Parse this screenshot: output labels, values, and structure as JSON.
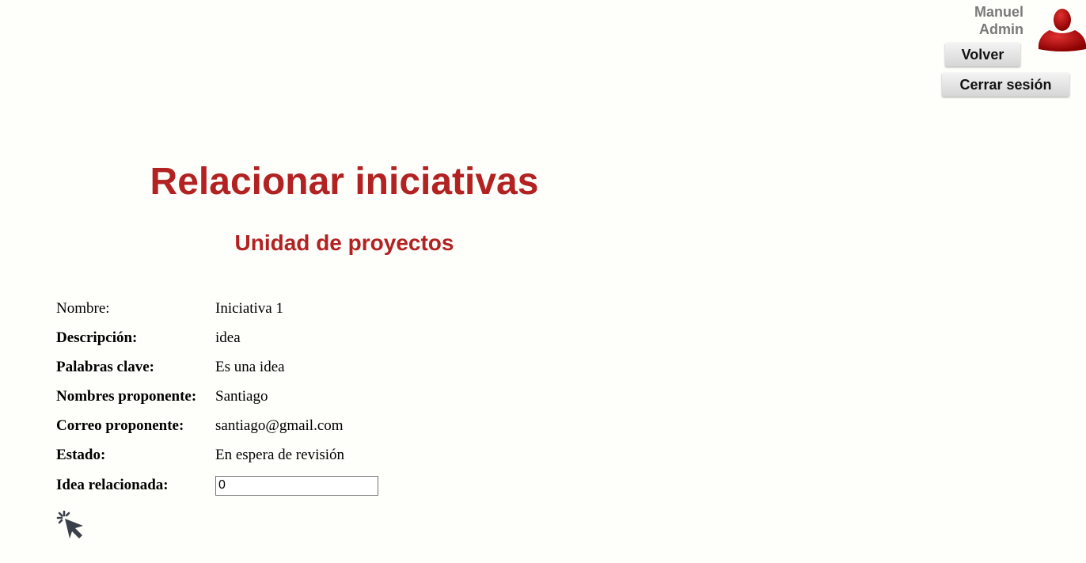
{
  "header": {
    "user_first_line": "Manuel",
    "user_second_line": "Admin",
    "avatar_icon": "user-silhouette-icon",
    "avatar_color": "#b00000",
    "back_button": "Volver",
    "logout_button": "Cerrar sesión"
  },
  "page": {
    "title": "Relacionar iniciativas",
    "subtitle": "Unidad de proyectos",
    "accent_color": "#b22222"
  },
  "fields": {
    "nombre_label": "Nombre:",
    "nombre_value": "Iniciativa 1",
    "descripcion_label": "Descripción:",
    "descripcion_value": "idea",
    "palabras_label": "Palabras clave:",
    "palabras_value": "Es una idea",
    "nombres_prop_label": "Nombres proponente:",
    "nombres_prop_value": "Santiago",
    "correo_label": "Correo proponente:",
    "correo_value": "santiago@gmail.com",
    "estado_label": "Estado:",
    "estado_value": "En espera de revisión",
    "idea_label": "Idea relacionada:",
    "idea_value": "0"
  },
  "action": {
    "submit_icon": "click-cursor-icon"
  }
}
